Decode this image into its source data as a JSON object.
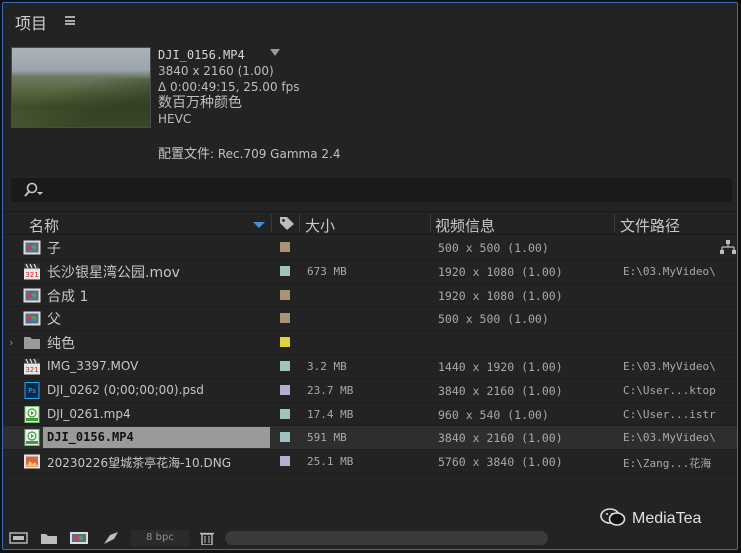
{
  "panel": {
    "title": "项目"
  },
  "preview": {
    "filename": "DJI_0156.MP4",
    "resolution": "3840 x 2160 (1.00)",
    "duration": "Δ 0:00:49:15, 25.00 fps",
    "colors": "数百万种颜色",
    "codec": "HEVC",
    "profile_label": "配置文件",
    "profile_value": ": Rec.709 Gamma 2.4"
  },
  "columns": {
    "name": "名称",
    "size": "大小",
    "video_info": "视频信息",
    "path": "文件路径"
  },
  "rows": [
    {
      "name": "子",
      "swatch": "#a89474",
      "size": "",
      "video": "500 x 500 (1.00)",
      "path": "",
      "icon": "composition-icon",
      "cjk": true,
      "flow": true
    },
    {
      "name": "长沙银星湾公园.mov",
      "swatch": "#9fc4c0",
      "size": "673 MB",
      "video": "1920 x 1080 (1.00)",
      "path": "E:\\03.MyVideo\\",
      "icon": "video-file-icon",
      "cjk": true
    },
    {
      "name": "合成 1",
      "swatch": "#a89474",
      "size": "",
      "video": "1920 x 1080 (1.00)",
      "path": "",
      "icon": "composition-icon",
      "cjk": true
    },
    {
      "name": "父",
      "swatch": "#a89474",
      "size": "",
      "video": "500 x 500 (1.00)",
      "path": "",
      "icon": "composition-icon",
      "cjk": true
    },
    {
      "name": "纯色",
      "swatch": "#e1d33e",
      "size": "",
      "video": "",
      "path": "",
      "icon": "folder-icon",
      "cjk": true,
      "twirl": true
    },
    {
      "name": "IMG_3397.MOV",
      "swatch": "#9fc4c0",
      "size": "3.2 MB",
      "video": "1440 x 1920 (1.00)",
      "path": "E:\\03.MyVideo\\",
      "icon": "video-file-icon"
    },
    {
      "name": "DJI_0262 (0;00;00;00).psd",
      "swatch": "#b3b1d2",
      "size": "23.7 MB",
      "video": "3840 x 2160 (1.00)",
      "path": "C:\\User...ktop",
      "icon": "photoshop-file-icon"
    },
    {
      "name": "DJI_0261.mp4",
      "swatch": "#9fc4c0",
      "size": "17.4 MB",
      "video": "960 x 540 (1.00)",
      "path": "C:\\User...istr",
      "icon": "mp4-file-icon"
    },
    {
      "name": "DJI_0156.MP4",
      "swatch": "#9fc4c0",
      "size": "591 MB",
      "video": "3840 x 2160 (1.00)",
      "path": "E:\\03.MyVideo\\",
      "icon": "mp4-file-icon",
      "selected": true
    },
    {
      "name": "20230226望城茶亭花海-10.DNG",
      "swatch": "#b3b1d2",
      "size": "25.1 MB",
      "video": "5760 x 3840 (1.00)",
      "path": "E:\\Zang...花海",
      "icon": "image-file-icon"
    }
  ],
  "footer": {
    "bpc": "8 bpc"
  },
  "watermark": {
    "text": "MediaTea"
  }
}
